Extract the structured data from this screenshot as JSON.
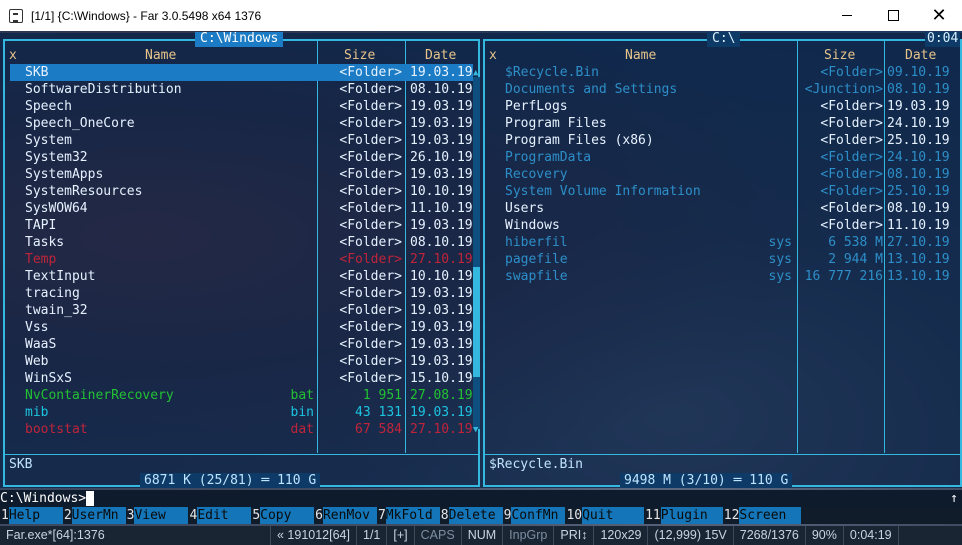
{
  "window": {
    "title": "[1/1] {C:\\Windows} - Far 3.0.5498 x64  1376"
  },
  "left": {
    "path": "C:\\Windows",
    "headers": {
      "x": "x",
      "name": "Name",
      "size": "Size",
      "date": "Date"
    },
    "rows": [
      {
        "name": "SKB",
        "ext": "",
        "size": "<Folder>",
        "date": "19.03.19",
        "style": "sel"
      },
      {
        "name": "SoftwareDistribution",
        "ext": "",
        "size": "<Folder>",
        "date": "08.10.19",
        "style": "norm"
      },
      {
        "name": "Speech",
        "ext": "",
        "size": "<Folder>",
        "date": "19.03.19",
        "style": "norm"
      },
      {
        "name": "Speech_OneCore",
        "ext": "",
        "size": "<Folder>",
        "date": "19.03.19",
        "style": "norm"
      },
      {
        "name": "System",
        "ext": "",
        "size": "<Folder>",
        "date": "19.03.19",
        "style": "norm"
      },
      {
        "name": "System32",
        "ext": "",
        "size": "<Folder>",
        "date": "26.10.19",
        "style": "norm"
      },
      {
        "name": "SystemApps",
        "ext": "",
        "size": "<Folder>",
        "date": "19.03.19",
        "style": "norm"
      },
      {
        "name": "SystemResources",
        "ext": "",
        "size": "<Folder>",
        "date": "10.10.19",
        "style": "norm"
      },
      {
        "name": "SysWOW64",
        "ext": "",
        "size": "<Folder>",
        "date": "11.10.19",
        "style": "norm"
      },
      {
        "name": "TAPI",
        "ext": "",
        "size": "<Folder>",
        "date": "19.03.19",
        "style": "norm"
      },
      {
        "name": "Tasks",
        "ext": "",
        "size": "<Folder>",
        "date": "08.10.19",
        "style": "norm"
      },
      {
        "name": "Temp",
        "ext": "",
        "size": "<Folder>",
        "date": "27.10.19",
        "style": "red"
      },
      {
        "name": "TextInput",
        "ext": "",
        "size": "<Folder>",
        "date": "10.10.19",
        "style": "norm"
      },
      {
        "name": "tracing",
        "ext": "",
        "size": "<Folder>",
        "date": "19.03.19",
        "style": "norm"
      },
      {
        "name": "twain_32",
        "ext": "",
        "size": "<Folder>",
        "date": "19.03.19",
        "style": "norm"
      },
      {
        "name": "Vss",
        "ext": "",
        "size": "<Folder>",
        "date": "19.03.19",
        "style": "norm"
      },
      {
        "name": "WaaS",
        "ext": "",
        "size": "<Folder>",
        "date": "19.03.19",
        "style": "norm"
      },
      {
        "name": "Web",
        "ext": "",
        "size": "<Folder>",
        "date": "19.03.19",
        "style": "norm"
      },
      {
        "name": "WinSxS",
        "ext": "",
        "size": "<Folder>",
        "date": "15.10.19",
        "style": "norm"
      },
      {
        "name": "NvContainerRecovery",
        "ext": "bat",
        "size": "1 951",
        "date": "27.08.19",
        "style": "green"
      },
      {
        "name": "mib",
        "ext": "bin",
        "size": "43 131",
        "date": "19.03.19",
        "style": "cyan"
      },
      {
        "name": "bootstat",
        "ext": "dat",
        "size": "67 584",
        "date": "27.10.19",
        "style": "red"
      }
    ],
    "current": "SKB",
    "footer": "6871 K (25/81)",
    "free": "110 G"
  },
  "right": {
    "path": "C:\\",
    "clock_fragment": "0:04",
    "headers": {
      "x": "x",
      "name": "Name",
      "size": "Size",
      "date": "Date"
    },
    "rows": [
      {
        "name": "$Recycle.Bin",
        "ext": "",
        "size": "<Folder>",
        "date": "09.10.19",
        "style": "dim"
      },
      {
        "name": "Documents and Settings",
        "ext": "",
        "size": "<Junction>",
        "date": "08.10.19",
        "style": "dim"
      },
      {
        "name": "PerfLogs",
        "ext": "",
        "size": "<Folder>",
        "date": "19.03.19",
        "style": "norm"
      },
      {
        "name": "Program Files",
        "ext": "",
        "size": "<Folder>",
        "date": "24.10.19",
        "style": "norm"
      },
      {
        "name": "Program Files (x86)",
        "ext": "",
        "size": "<Folder>",
        "date": "25.10.19",
        "style": "norm"
      },
      {
        "name": "ProgramData",
        "ext": "",
        "size": "<Folder>",
        "date": "24.10.19",
        "style": "dim"
      },
      {
        "name": "Recovery",
        "ext": "",
        "size": "<Folder>",
        "date": "08.10.19",
        "style": "dim"
      },
      {
        "name": "System Volume Information",
        "ext": "",
        "size": "<Folder>",
        "date": "25.10.19",
        "style": "dim"
      },
      {
        "name": "Users",
        "ext": "",
        "size": "<Folder>",
        "date": "08.10.19",
        "style": "norm"
      },
      {
        "name": "Windows",
        "ext": "",
        "size": "<Folder>",
        "date": "11.10.19",
        "style": "norm"
      },
      {
        "name": "hiberfil",
        "ext": "sys",
        "size": "6 538 M",
        "date": "27.10.19",
        "style": "dim"
      },
      {
        "name": "pagefile",
        "ext": "sys",
        "size": "2 944 M",
        "date": "13.10.19",
        "style": "dim"
      },
      {
        "name": "swapfile",
        "ext": "sys",
        "size": "16 777 216",
        "date": "13.10.19",
        "style": "dim"
      }
    ],
    "current": "$Recycle.Bin",
    "footer": "9498 M (3/10)",
    "free": "110 G"
  },
  "command": {
    "prompt": "C:\\Windows>",
    "right_marker": "↑"
  },
  "keybar": [
    {
      "num": "1",
      "label": "Help"
    },
    {
      "num": "2",
      "label": "UserMn"
    },
    {
      "num": "3",
      "label": "View"
    },
    {
      "num": "4",
      "label": "Edit"
    },
    {
      "num": "5",
      "label": "Copy"
    },
    {
      "num": "6",
      "label": "RenMov"
    },
    {
      "num": "7",
      "label": "MkFold"
    },
    {
      "num": "8",
      "label": "Delete"
    },
    {
      "num": "9",
      "label": "ConfMn"
    },
    {
      "num": "10",
      "label": "Quit"
    },
    {
      "num": "11",
      "label": "Plugin"
    },
    {
      "num": "12",
      "label": "Screen"
    }
  ],
  "status": [
    {
      "text": "Far.exe*[64]:1376",
      "dim": false
    },
    {
      "text": "« 191012[64]",
      "dim": false
    },
    {
      "text": "1/1",
      "dim": false
    },
    {
      "text": "[+]",
      "dim": false
    },
    {
      "text": "CAPS",
      "dim": true
    },
    {
      "text": "NUM",
      "dim": false
    },
    {
      "text": "InpGrp",
      "dim": true
    },
    {
      "text": "PRI↕",
      "dim": false
    },
    {
      "text": "120x29",
      "dim": false
    },
    {
      "text": "(12,999) 15V",
      "dim": false
    },
    {
      "text": "7268/1376",
      "dim": false
    },
    {
      "text": "90%",
      "dim": false
    },
    {
      "text": "0:04:19",
      "dim": false
    }
  ],
  "colors": {
    "frame": "#35b8e0",
    "selection": "#1b7bc4",
    "accent": "#1476b8"
  }
}
